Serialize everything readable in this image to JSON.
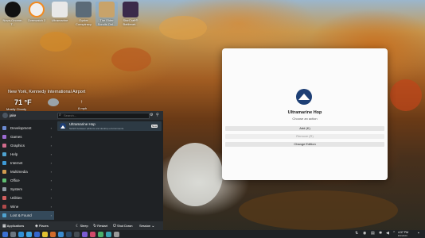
{
  "desktop": {
    "icons": [
      {
        "label": "Nova-Gnome-T...",
        "icon": "app-icon"
      },
      {
        "label": "Overwatch 2",
        "icon": "overwatch-icon"
      },
      {
        "label": "Ultramarine",
        "icon": "app-icon"
      },
      {
        "label": "Oyster Conspiracy",
        "icon": "game-icon"
      },
      {
        "label": "The Elder Scrolls Onl...",
        "icon": "game-icon"
      },
      {
        "label": "StarCraft® Battlenet...",
        "icon": "game-icon"
      }
    ]
  },
  "weather": {
    "location": "New York, Kennedy International Airport",
    "temperature": "71 °F",
    "condition": "Mostly Cloudy",
    "wind": "8 mph"
  },
  "dialog": {
    "title": "Ultramarine Hop",
    "subtitle": "Choose an action",
    "buttons": [
      {
        "label": "Add (K)",
        "enabled": true
      },
      {
        "label": "Remove (R)",
        "enabled": false
      },
      {
        "label": "Change Edition",
        "enabled": true
      }
    ]
  },
  "start_menu": {
    "user": "jake",
    "search_placeholder": "Search...",
    "categories": [
      {
        "label": "Development",
        "color": "#6c8bd1"
      },
      {
        "label": "Games",
        "color": "#9c6bd1"
      },
      {
        "label": "Graphics",
        "color": "#d16b8c"
      },
      {
        "label": "Help",
        "color": "#4fa3d1"
      },
      {
        "label": "Internet",
        "color": "#3e9ad6"
      },
      {
        "label": "Multimedia",
        "color": "#d19b4f"
      },
      {
        "label": "Office",
        "color": "#5fbf72"
      },
      {
        "label": "System",
        "color": "#8f9aa3"
      },
      {
        "label": "Utilities",
        "color": "#d15f5f"
      },
      {
        "label": "Wine",
        "color": "#b04a4a"
      },
      {
        "label": "Lost & Found",
        "color": "#4fa3d1"
      }
    ],
    "active_category": "Lost & Found",
    "app": {
      "name": "Ultramarine Hop",
      "description": "Switch between editions and desktop environments",
      "badge": "New"
    },
    "footer": {
      "applications": "Applications",
      "places": "Places",
      "sleep": "Sleep",
      "restart": "Restart",
      "shutdown": "Shut Down",
      "session": "Session"
    }
  },
  "taskbar": {
    "apps": [
      {
        "icon": "start-menu-icon",
        "color": "#3b6fd1"
      },
      {
        "icon": "task-view-icon",
        "color": "#6b7580"
      },
      {
        "icon": "app-store-icon",
        "color": "#2f8fd6"
      },
      {
        "icon": "file-manager-icon",
        "color": "#3fa3e0"
      },
      {
        "icon": "browser-icon",
        "color": "#3366cc"
      },
      {
        "icon": "chrome-icon",
        "color": "#e0c030"
      },
      {
        "icon": "app-icon",
        "color": "#d06a2a"
      },
      {
        "icon": "chat-icon",
        "color": "#3a8bd0"
      },
      {
        "icon": "steam-icon",
        "color": "#2b4a6a"
      },
      {
        "icon": "terminal-icon",
        "color": "#444b52"
      },
      {
        "icon": "app-icon",
        "color": "#7a5bd1"
      },
      {
        "icon": "app-icon",
        "color": "#d14a6a"
      },
      {
        "icon": "app-icon",
        "color": "#4ab06a"
      },
      {
        "icon": "app-icon",
        "color": "#3aa0b0"
      },
      {
        "icon": "app-icon",
        "color": "#999999"
      }
    ],
    "clock_time": "4:37 PM",
    "clock_date": "8/1/2023"
  }
}
